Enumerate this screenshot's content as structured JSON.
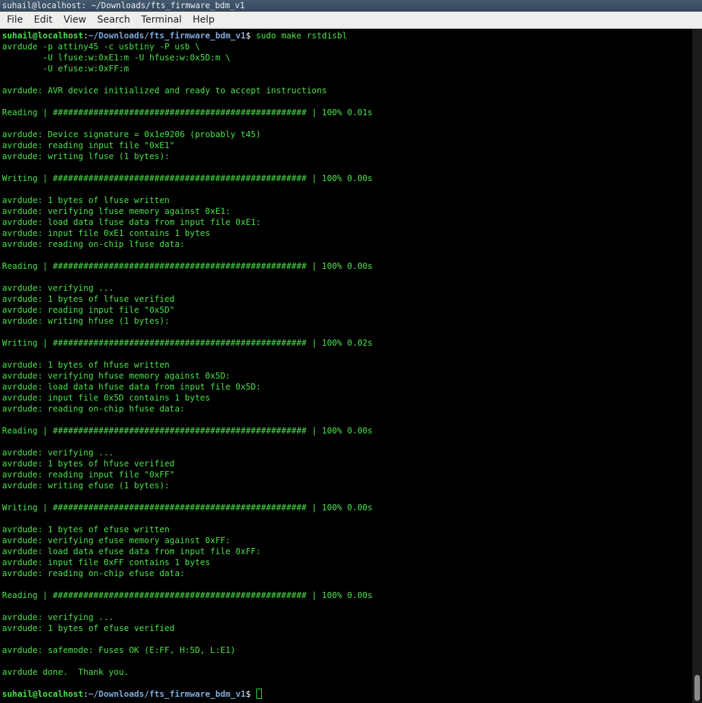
{
  "window": {
    "title": "suhail@localhost: ~/Downloads/fts_firmware_bdm_v1"
  },
  "menu": [
    "File",
    "Edit",
    "View",
    "Search",
    "Terminal",
    "Help"
  ],
  "prompt": {
    "user": "suhail@localhost",
    "sep": ":",
    "path": "~/Downloads/fts_firmware_bdm_v1",
    "dollar": "$ "
  },
  "command": "sudo make rstdisbl",
  "output": [
    "avrdude -p attiny45 -c usbtiny -P usb \\",
    "        -U lfuse:w:0xE1:m -U hfuse:w:0x5D:m \\",
    "        -U efuse:w:0xFF:m",
    "",
    "avrdude: AVR device initialized and ready to accept instructions",
    "",
    "Reading | ################################################## | 100% 0.01s",
    "",
    "avrdude: Device signature = 0x1e9206 (probably t45)",
    "avrdude: reading input file \"0xE1\"",
    "avrdude: writing lfuse (1 bytes):",
    "",
    "Writing | ################################################## | 100% 0.00s",
    "",
    "avrdude: 1 bytes of lfuse written",
    "avrdude: verifying lfuse memory against 0xE1:",
    "avrdude: load data lfuse data from input file 0xE1:",
    "avrdude: input file 0xE1 contains 1 bytes",
    "avrdude: reading on-chip lfuse data:",
    "",
    "Reading | ################################################## | 100% 0.00s",
    "",
    "avrdude: verifying ...",
    "avrdude: 1 bytes of lfuse verified",
    "avrdude: reading input file \"0x5D\"",
    "avrdude: writing hfuse (1 bytes):",
    "",
    "Writing | ################################################## | 100% 0.02s",
    "",
    "avrdude: 1 bytes of hfuse written",
    "avrdude: verifying hfuse memory against 0x5D:",
    "avrdude: load data hfuse data from input file 0x5D:",
    "avrdude: input file 0x5D contains 1 bytes",
    "avrdude: reading on-chip hfuse data:",
    "",
    "Reading | ################################################## | 100% 0.00s",
    "",
    "avrdude: verifying ...",
    "avrdude: 1 bytes of hfuse verified",
    "avrdude: reading input file \"0xFF\"",
    "avrdude: writing efuse (1 bytes):",
    "",
    "Writing | ################################################## | 100% 0.00s",
    "",
    "avrdude: 1 bytes of efuse written",
    "avrdude: verifying efuse memory against 0xFF:",
    "avrdude: load data efuse data from input file 0xFF:",
    "avrdude: input file 0xFF contains 1 bytes",
    "avrdude: reading on-chip efuse data:",
    "",
    "Reading | ################################################## | 100% 0.00s",
    "",
    "avrdude: verifying ...",
    "avrdude: 1 bytes of efuse verified",
    "",
    "avrdude: safemode: Fuses OK (E:FF, H:5D, L:E1)",
    "",
    "avrdude done.  Thank you.",
    ""
  ],
  "colors": {
    "terminal_fg": "#4ae04a",
    "terminal_bg": "#000000",
    "path": "#7fa8d8"
  }
}
